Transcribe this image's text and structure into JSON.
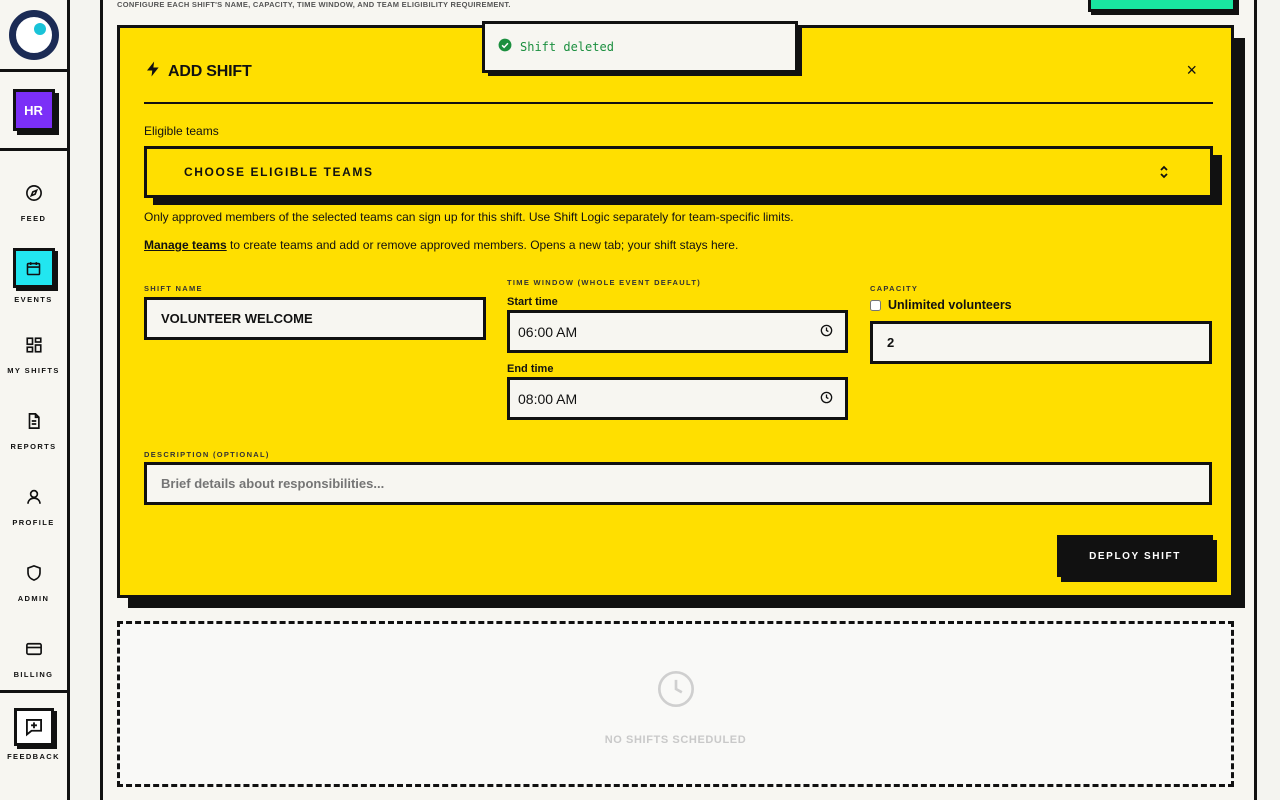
{
  "sidebar": {
    "org_initials": "HR",
    "items": [
      {
        "label": "FEED",
        "icon": "compass-icon"
      },
      {
        "label": "EVENTS",
        "icon": "calendar-icon",
        "active": true
      },
      {
        "label": "MY SHIFTS",
        "icon": "grid-icon"
      },
      {
        "label": "REPORTS",
        "icon": "document-icon"
      },
      {
        "label": "PROFILE",
        "icon": "user-icon"
      },
      {
        "label": "ADMIN",
        "icon": "shield-icon"
      },
      {
        "label": "BILLING",
        "icon": "credit-card-icon"
      },
      {
        "label": "FEEDBACK",
        "icon": "feedback-icon"
      }
    ]
  },
  "header": {
    "subtitle": "CONFIGURE EACH SHIFT'S NAME, CAPACITY, TIME WINDOW, AND TEAM ELIGIBILITY REQUIREMENT."
  },
  "toast": {
    "message": "Shift deleted"
  },
  "modal": {
    "title": "ADD SHIFT",
    "close": "×",
    "eligible_teams_label": "Eligible teams",
    "eligible_teams_select": "CHOOSE ELIGIBLE TEAMS",
    "help_text": "Only approved members of the selected teams can sign up for this shift. Use Shift Logic separately for team-specific limits.",
    "manage_link": "Manage teams",
    "manage_text": " to create teams and add or remove approved members. Opens a new tab; your shift stays here.",
    "shift_name_label": "SHIFT NAME",
    "shift_name_value": "VOLUNTEER WELCOME",
    "time_window_label": "TIME WINDOW (WHOLE EVENT DEFAULT)",
    "start_time_label": "Start time",
    "start_time_value": "06:00 AM",
    "end_time_label": "End time",
    "end_time_value": "08:00 AM",
    "capacity_label": "CAPACITY",
    "unlimited_label": "Unlimited volunteers",
    "unlimited_checked": false,
    "capacity_value": "2",
    "description_label": "DESCRIPTION (OPTIONAL)",
    "description_placeholder": "Brief details about responsibilities...",
    "deploy_button": "DEPLOY SHIFT"
  },
  "empty_state": {
    "text": "NO SHIFTS SCHEDULED"
  },
  "colors": {
    "modal_bg": "#ffdf00",
    "active_nav": "#22e6f0",
    "org_badge": "#7b2ff7",
    "toast_text": "#1b8f3f",
    "header_button": "#19e6a0"
  }
}
